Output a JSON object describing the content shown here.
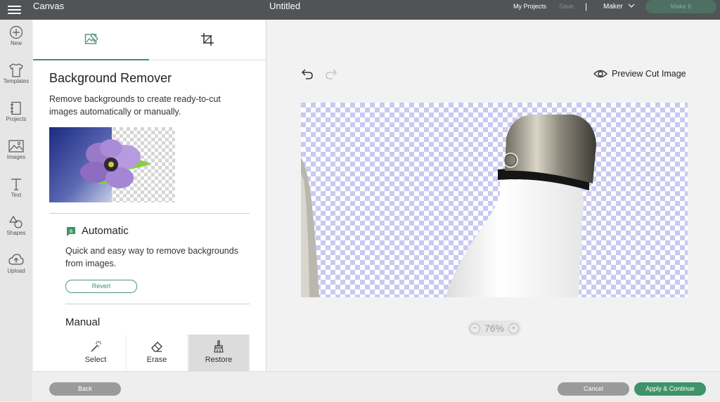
{
  "header": {
    "app_name": "Canvas",
    "document_title": "Untitled",
    "my_projects": "My Projects",
    "save": "Save",
    "divider": "|",
    "machine": "Maker",
    "make_it": "Make It"
  },
  "sidebar": {
    "items": [
      {
        "label": "New",
        "icon": "plus-circle-icon"
      },
      {
        "label": "Templates",
        "icon": "shirt-icon"
      },
      {
        "label": "Projects",
        "icon": "projects-icon"
      },
      {
        "label": "Images",
        "icon": "image-icon"
      },
      {
        "label": "Text",
        "icon": "text-icon"
      },
      {
        "label": "Shapes",
        "icon": "shapes-icon"
      },
      {
        "label": "Upload",
        "icon": "upload-icon"
      }
    ]
  },
  "panel": {
    "tabs": [
      {
        "icon": "background-remove-icon",
        "active": true
      },
      {
        "icon": "crop-icon",
        "active": false
      }
    ],
    "title": "Background Remover",
    "description": "Remove backgrounds to create ready-to-cut images automatically or manually.",
    "automatic": {
      "title": "Automatic",
      "description": "Quick and easy way to remove backgrounds from images.",
      "revert": "Revert"
    },
    "manual": {
      "title": "Manual",
      "tools": [
        {
          "label": "Select",
          "icon": "magic-wand-icon",
          "active": false
        },
        {
          "label": "Erase",
          "icon": "eraser-icon",
          "active": false
        },
        {
          "label": "Restore",
          "icon": "restore-brush-icon",
          "active": true
        }
      ]
    }
  },
  "canvas": {
    "preview_label": "Preview Cut Image",
    "zoom": "76%",
    "zoom_minus": "−",
    "zoom_plus": "+"
  },
  "footer": {
    "back": "Back",
    "cancel": "Cancel",
    "apply": "Apply & Continue"
  },
  "colors": {
    "accent": "#3e9468",
    "topbar": "#505457",
    "checker": "#c9c9f2"
  }
}
